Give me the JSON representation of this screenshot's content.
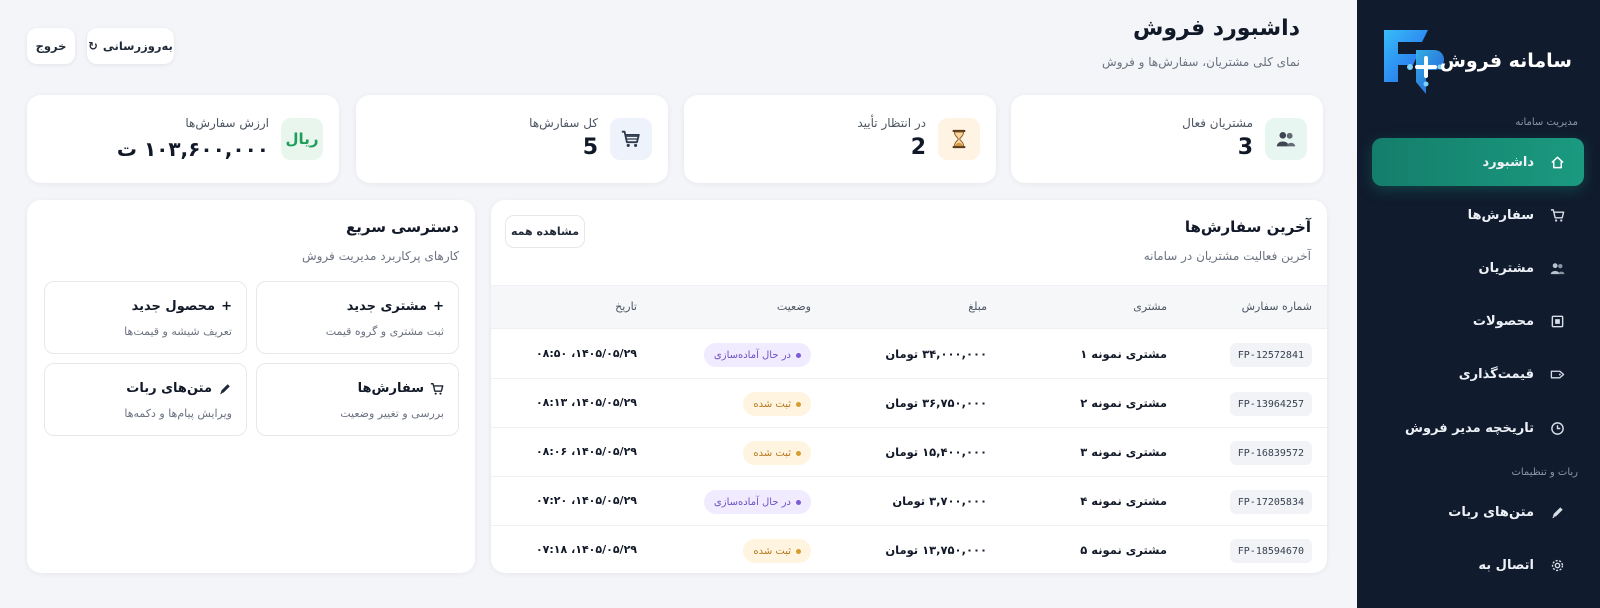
{
  "brand": {
    "title": "سامانه فروش"
  },
  "sidebar": {
    "section_management": "مدیریت سامانه",
    "section_bot": "ربات و تنظیمات",
    "items": [
      {
        "label": "داشبورد",
        "icon": "home-icon",
        "active": true
      },
      {
        "label": "سفارش‌ها",
        "icon": "cart-icon"
      },
      {
        "label": "مشتریان",
        "icon": "users-icon"
      },
      {
        "label": "محصولات",
        "icon": "box-icon"
      },
      {
        "label": "قیمت‌گذاری",
        "icon": "tag-icon"
      },
      {
        "label": "تاریخچه مدیر فروش",
        "icon": "clock-icon"
      },
      {
        "label": "متن‌های ربات",
        "icon": "pencil-icon"
      },
      {
        "label": "اتصال به",
        "icon": "gear-icon"
      }
    ]
  },
  "header": {
    "title": "داشبورد فروش",
    "subtitle": "نمای کلی مشتریان، سفارش‌ها و فروش",
    "refresh_label": "به‌روزرسانی",
    "refresh_icon": "↻",
    "logout_label": "خروج"
  },
  "stats": [
    {
      "label": "مشتریان فعال",
      "value": "3",
      "icon": "users-icon",
      "icon_bg": "#e8f6f1"
    },
    {
      "label": "در انتظار تأیید",
      "value": "2",
      "icon": "hourglass-icon",
      "icon_bg": "#fff3e3"
    },
    {
      "label": "کل سفارش‌ها",
      "value": "5",
      "icon": "cart-icon",
      "icon_bg": "#eef2fb"
    },
    {
      "label": "ارزش سفارش‌ها",
      "value": "۱۰۳,۶۰۰,۰۰۰ ت",
      "icon_text": "ریال",
      "icon_bg": "#e8f6ee"
    }
  ],
  "orders": {
    "title": "آخرین سفارش‌ها",
    "subtitle": "آخرین فعالیت مشتریان در سامانه",
    "view_all": "مشاهده همه",
    "columns": [
      "شماره سفارش",
      "مشتری",
      "مبلغ",
      "وضعیت",
      "تاریخ"
    ],
    "rows": [
      {
        "id": "FP-12572841",
        "customer": "مشتری نمونه ۱",
        "amount": "۳۴,۰۰۰,۰۰۰ تومان",
        "status": "در حال آماده‌سازی",
        "status_type": "prep",
        "date": "۱۴۰۵/۰۵/۲۹، ۰۸:۵۰"
      },
      {
        "id": "FP-13964257",
        "customer": "مشتری نمونه ۲",
        "amount": "۳۶,۷۵۰,۰۰۰ تومان",
        "status": "ثبت شده",
        "status_type": "reg",
        "date": "۱۴۰۵/۰۵/۲۹، ۰۸:۱۳"
      },
      {
        "id": "FP-16839572",
        "customer": "مشتری نمونه ۳",
        "amount": "۱۵,۴۰۰,۰۰۰ تومان",
        "status": "ثبت شده",
        "status_type": "reg",
        "date": "۱۴۰۵/۰۵/۲۹، ۰۸:۰۶"
      },
      {
        "id": "FP-17205834",
        "customer": "مشتری نمونه ۴",
        "amount": "۳,۷۰۰,۰۰۰ تومان",
        "status": "در حال آماده‌سازی",
        "status_type": "prep",
        "date": "۱۴۰۵/۰۵/۲۹، ۰۷:۲۰"
      },
      {
        "id": "FP-18594670",
        "customer": "مشتری نمونه ۵",
        "amount": "۱۳,۷۵۰,۰۰۰ تومان",
        "status": "ثبت شده",
        "status_type": "reg",
        "date": "۱۴۰۵/۰۵/۲۹، ۰۷:۱۸"
      }
    ]
  },
  "quick": {
    "title": "دسترسی سریع",
    "subtitle": "کارهای پرکاربرد مدیریت فروش",
    "cards": [
      {
        "title": "مشتری جدید",
        "sub": "ثبت مشتری و گروه قیمت",
        "icon": "plus-icon"
      },
      {
        "title": "محصول جدید",
        "sub": "تعریف شیشه و قیمت‌ها",
        "icon": "plus-icon"
      },
      {
        "title": "سفارش‌ها",
        "sub": "بررسی و تغییر وضعیت",
        "icon": "cart-icon"
      },
      {
        "title": "متن‌های ربات",
        "sub": "ویرایش پیام‌ها و دکمه‌ها",
        "icon": "pencil-icon"
      }
    ]
  },
  "colors": {
    "sidebar_bg": "#101b2e",
    "accent": "#1b9a80",
    "page_bg": "#f3f5f9"
  }
}
